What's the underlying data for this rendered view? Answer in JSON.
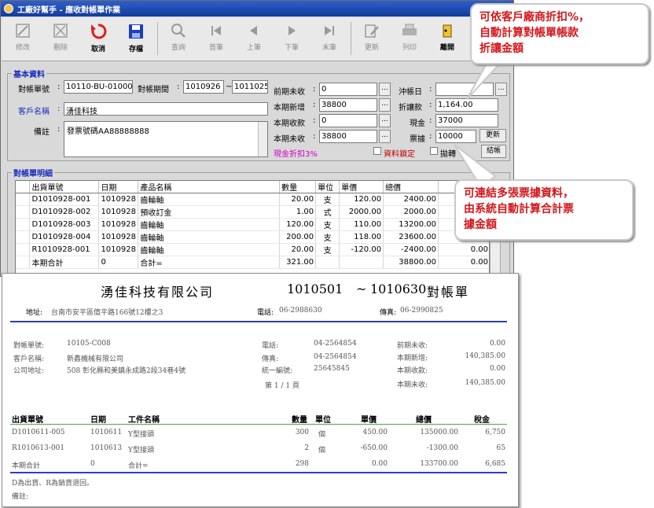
{
  "window": {
    "title": "工廠好幫手 - 應收對帳單作業"
  },
  "toolbar": [
    {
      "label": "修改",
      "icon": "edit-icon",
      "enabled": false
    },
    {
      "label": "刪除",
      "icon": "delete-icon",
      "enabled": false
    },
    {
      "label": "取消",
      "icon": "cancel-icon",
      "enabled": true
    },
    {
      "label": "存檔",
      "icon": "save-icon",
      "enabled": true
    },
    {
      "label": "查詢",
      "icon": "search-icon",
      "enabled": false
    },
    {
      "label": "首筆",
      "icon": "first-record-icon",
      "enabled": false
    },
    {
      "label": "上筆",
      "icon": "prev-record-icon",
      "enabled": false
    },
    {
      "label": "下筆",
      "icon": "next-record-icon",
      "enabled": false
    },
    {
      "label": "末筆",
      "icon": "last-record-icon",
      "enabled": false
    },
    {
      "label": "更新",
      "icon": "refresh-icon",
      "enabled": false
    },
    {
      "label": "列印",
      "icon": "print-icon",
      "enabled": false
    },
    {
      "label": "離開",
      "icon": "exit-icon",
      "enabled": true
    }
  ],
  "basic": {
    "group_title": "基本資料",
    "bill_no_label": "對帳單號",
    "bill_no": "10110-BU-01000",
    "period_label": "對帳期間",
    "period_from": "1010926",
    "period_sep": "~",
    "period_to": "1011025",
    "customer_label": "客戶名稱",
    "customer": "湧佳科技",
    "memo_label": "備註",
    "memo": "發票號碼AA88888888",
    "prev_unpaid_label": "前期未收",
    "prev_unpaid": "0",
    "new_label": "本期新增",
    "new_amount": "38800",
    "received_label": "本期收款",
    "received": "0",
    "unpaid_label": "本期未收",
    "unpaid": "38800",
    "cash_discount": "現金折扣3%",
    "offset_date_label": "沖帳日",
    "offset_date": "",
    "discount_label": "折讓款",
    "discount": "1,164.00",
    "cash_label": "現金",
    "cash": "37000",
    "ticket_label": "票據",
    "ticket": "10000",
    "refresh_label": "更新",
    "lock_label": "資料鎖定",
    "transfer_label": "拋轉",
    "post_label": "結帳"
  },
  "detail": {
    "group_title": "對帳單明細",
    "columns": [
      "出貨單號",
      "日期",
      "產品名稱",
      "數量",
      "單位",
      "單價",
      "總價"
    ],
    "rows": [
      [
        "D1010928-001",
        "1010928",
        "齒輪軸",
        "20.00",
        "支",
        "120.00",
        "2400.00",
        "0.00"
      ],
      [
        "D1010928-002",
        "1010928",
        "預收訂金",
        "1.00",
        "式",
        "2000.00",
        "2000.00",
        "0.00"
      ],
      [
        "D1010928-003",
        "1010928",
        "齒輪軸",
        "120.00",
        "支",
        "110.00",
        "13200.00",
        "0.00"
      ],
      [
        "D1010928-004",
        "1010928",
        "齒輪軸",
        "200.00",
        "支",
        "118.00",
        "23600.00",
        "0.00"
      ],
      [
        "R1010928-001",
        "1010928",
        "齒輪軸",
        "20.00",
        "支",
        "-120.00",
        "-2400.00",
        "0.00"
      ],
      [
        "本期合計",
        "0",
        "合計=",
        "321.00",
        "",
        "",
        "38800.00",
        "0.00"
      ]
    ]
  },
  "report": {
    "company": "湧佳科技有限公司",
    "range_from": "1010501",
    "range_sep": "~",
    "range_to": "1010630",
    "doc_title": "對帳單",
    "address_label": "地址:",
    "address": "台南市安平區億平路166號12樓之3",
    "phone_label": "電話:",
    "phone": "06-2988630",
    "fax_label": "傳真:",
    "fax": "06-2990825",
    "bill_no_label": "對帳單號:",
    "bill_no": "10105-C008",
    "cust_label": "客戶名稱:",
    "cust": "新鑫機械有限公司",
    "cust_addr_label": "公司地址:",
    "cust_addr": "508 彰化縣和美鎮永成路2段34巷4號",
    "cust_phone_label": "電話:",
    "cust_phone": "04-2564854",
    "cust_fax_label": "傳真:",
    "cust_fax": "04-2564854",
    "tax_label": "統一編號:",
    "tax": "25645845",
    "page_info": "第 1 / 1 頁",
    "prev_label": "前期未收:",
    "prev": "0.00",
    "new_label": "本期新增:",
    "new": "140,385.00",
    "recv_label": "本期收款:",
    "recv": "0.00",
    "unpaid_label": "本期未收:",
    "unpaid": "140,385.00",
    "columns": [
      "出貨單號",
      "日期",
      "工件名稱",
      "數量",
      "單位",
      "單價",
      "總價",
      "稅金"
    ],
    "rows": [
      [
        "D1010611-005",
        "1010611",
        "Y型接頭",
        "300",
        "個",
        "450.00",
        "135000.00",
        "6,750"
      ],
      [
        "R1010613-001",
        "1010613",
        "Y型接頭",
        "2",
        "個",
        "-650.00",
        "-1300.00",
        "65"
      ],
      [
        "本期合計",
        "0",
        "合計=",
        "298",
        "",
        "0.00",
        "133700.00",
        "6,685"
      ]
    ],
    "note1": "D為出貨、R為銷貨退回。",
    "note2": "備註:"
  },
  "callouts": {
    "top": [
      "可依客戶廠商折扣%，",
      "自動計算對帳單帳款",
      "折讓金額"
    ],
    "mid": [
      "可連結多張票據資料，",
      "由系統自動計算合計票",
      "據金額"
    ]
  },
  "colors": {
    "title_bar": "#1f4bb5",
    "accent_blue": "#1a2dbd",
    "callout_red": "#d4161b",
    "cash_discount": "#d100c9",
    "report_rule": "#2d3dc6"
  }
}
